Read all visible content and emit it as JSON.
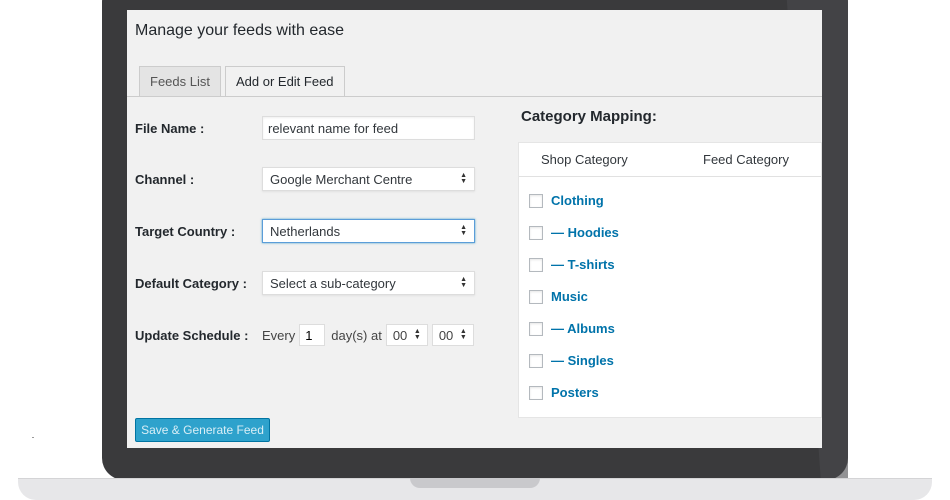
{
  "page": {
    "title": "Manage your feeds with ease"
  },
  "tabs": [
    {
      "label": "Feeds List",
      "active": false
    },
    {
      "label": "Add or Edit Feed",
      "active": true
    }
  ],
  "form": {
    "file_name": {
      "label": "File Name :",
      "value": "relevant name for feed"
    },
    "channel": {
      "label": "Channel :",
      "value": "Google Merchant Centre"
    },
    "target_country": {
      "label": "Target Country :",
      "value": "Netherlands"
    },
    "default_category": {
      "label": "Default Category :",
      "value": "Select a sub-category"
    },
    "update_schedule": {
      "label": "Update Schedule :",
      "every_label": "Every",
      "days_value": "1",
      "days_label": "day(s) at",
      "hour": "00",
      "minute": "00"
    },
    "save_label": "Save & Generate Feed"
  },
  "mapping": {
    "title": "Category Mapping:",
    "col_shop": "Shop Category",
    "col_feed": "Feed Category",
    "categories": [
      {
        "label": "Clothing"
      },
      {
        "label": "— Hoodies"
      },
      {
        "label": "— T-shirts"
      },
      {
        "label": "Music"
      },
      {
        "label": "— Albums"
      },
      {
        "label": "— Singles"
      },
      {
        "label": "Posters"
      }
    ]
  },
  "colors": {
    "link": "#0073aa",
    "button": "#2ea2cc",
    "focus": "#5b9dd9",
    "laptop": "#3a3a3c"
  }
}
